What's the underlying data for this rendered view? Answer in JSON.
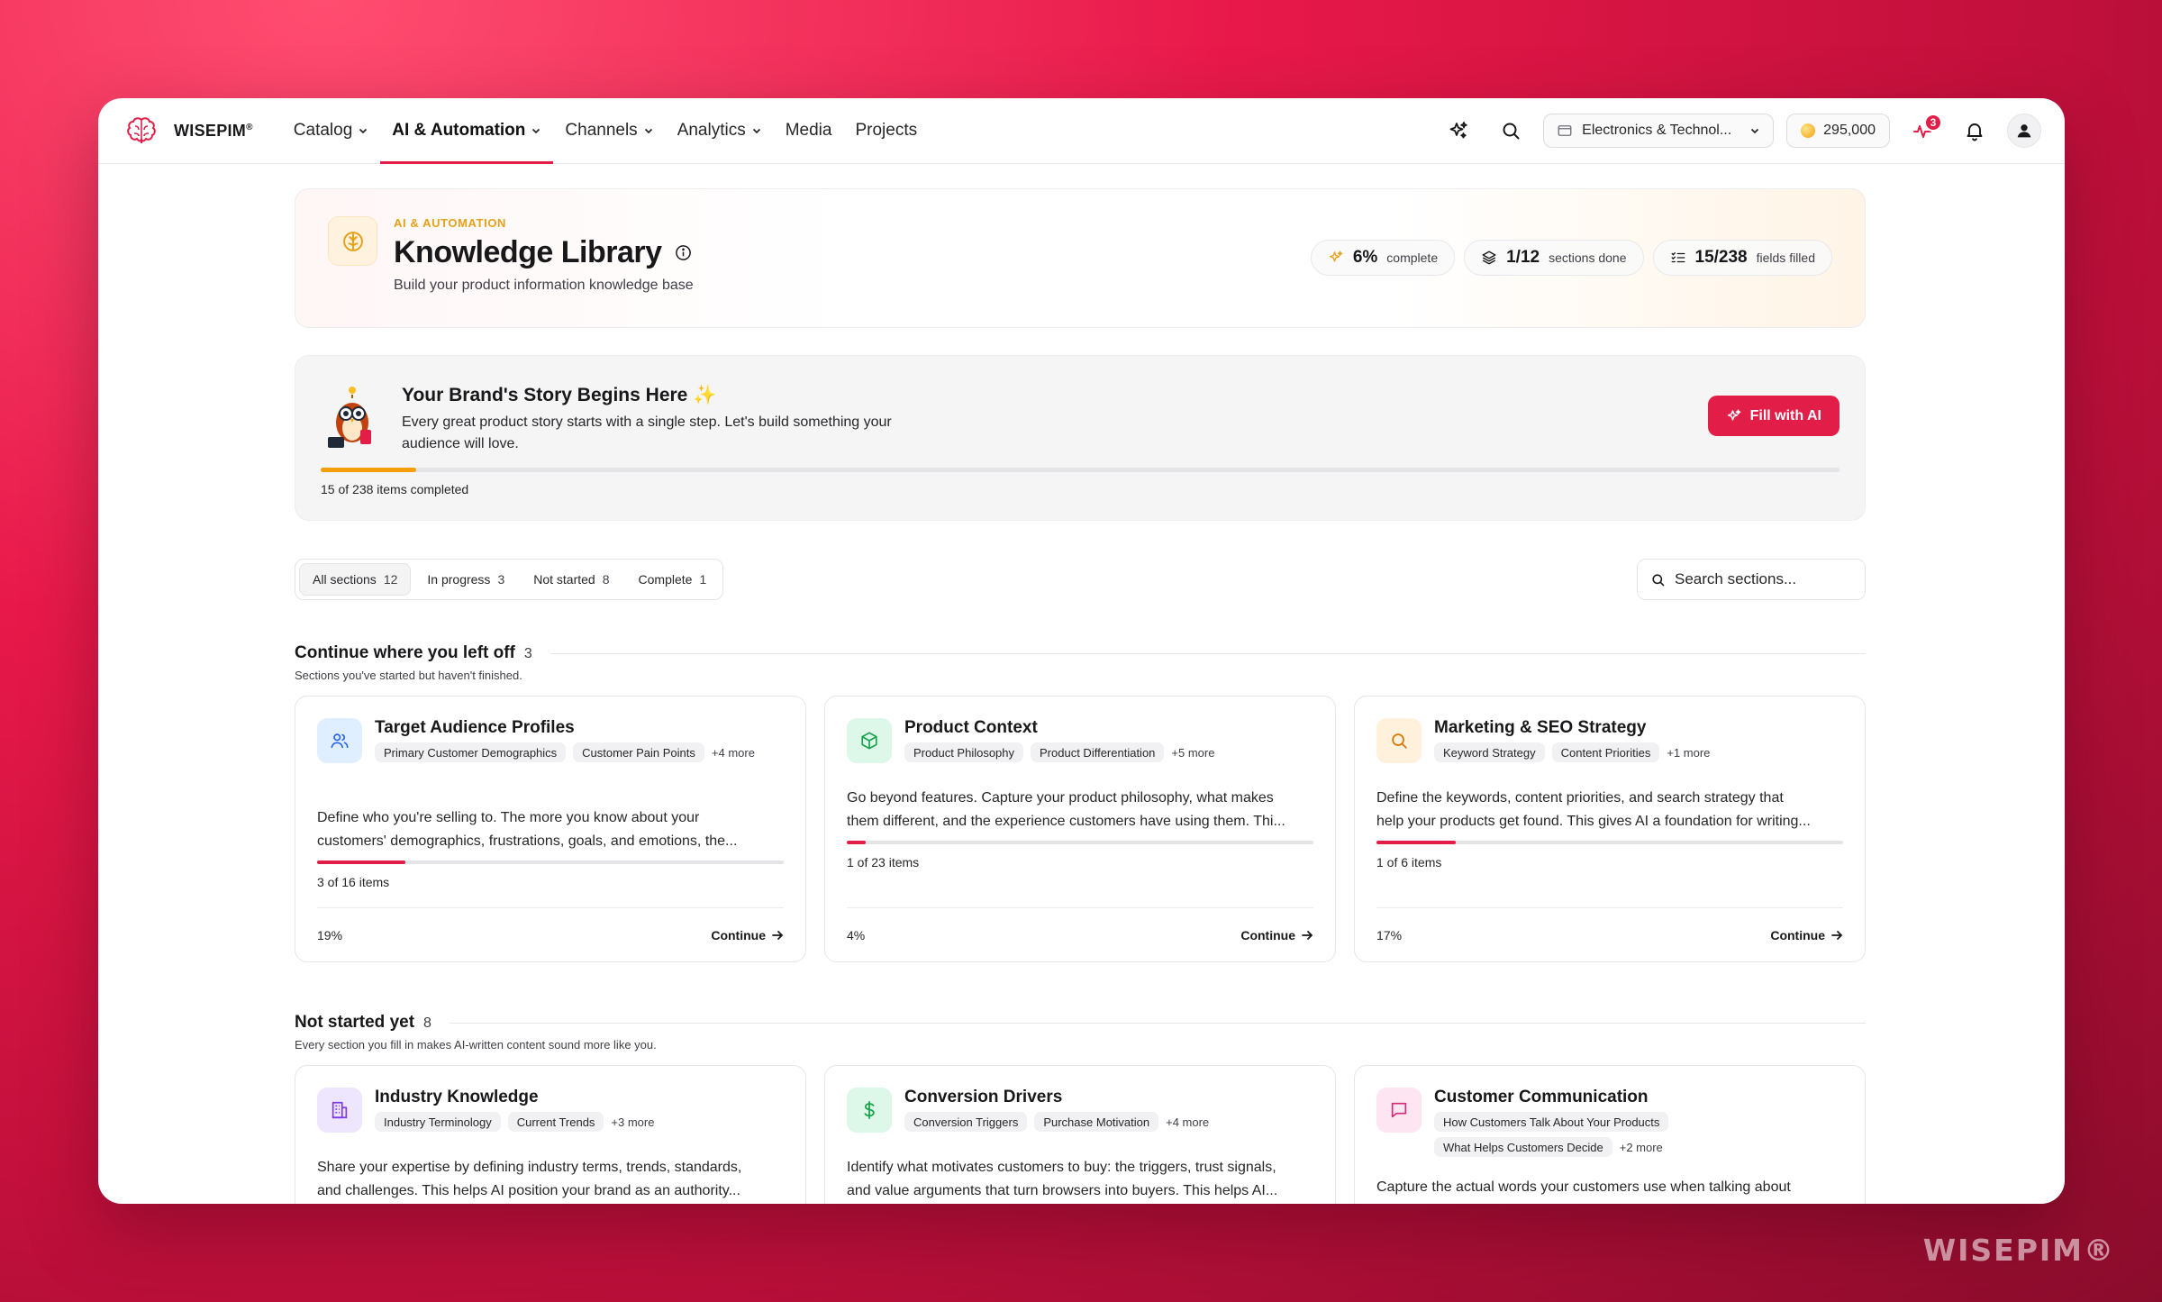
{
  "brand": {
    "name": "WISEPIM",
    "mark": "®",
    "watermark": "WISEPIM®"
  },
  "nav": {
    "items": [
      {
        "label": "Catalog",
        "dropdown": true,
        "active": false
      },
      {
        "label": "AI & Automation",
        "dropdown": true,
        "active": true
      },
      {
        "label": "Channels",
        "dropdown": true,
        "active": false
      },
      {
        "label": "Analytics",
        "dropdown": true,
        "active": false
      },
      {
        "label": "Media",
        "dropdown": false,
        "active": false
      },
      {
        "label": "Projects",
        "dropdown": false,
        "active": false
      }
    ],
    "store_selector": "Electronics & Technol...",
    "credits": "295,000",
    "activity_badge": "3"
  },
  "header": {
    "eyebrow": "AI & AUTOMATION",
    "title": "Knowledge Library",
    "subtitle": "Build your product information knowledge base",
    "stats": [
      {
        "value": "6%",
        "label": "complete",
        "icon": "sparkle-icon"
      },
      {
        "value": "1/12",
        "label": "sections done",
        "icon": "layers-icon"
      },
      {
        "value": "15/238",
        "label": "fields filled",
        "icon": "checklist-icon"
      }
    ]
  },
  "story": {
    "title": "Your Brand's Story Begins Here",
    "sparkle": "✨",
    "body": "Every great product story starts with a single step. Let's build something your audience will love.",
    "button": "Fill with AI",
    "progress_fraction": 0.063,
    "count_text": "15 of 238 items completed"
  },
  "filters": {
    "tabs": [
      {
        "label": "All sections",
        "count": "12",
        "active": true
      },
      {
        "label": "In progress",
        "count": "3",
        "active": false
      },
      {
        "label": "Not started",
        "count": "8",
        "active": false
      },
      {
        "label": "Complete",
        "count": "1",
        "active": false
      }
    ],
    "search_placeholder": "Search sections..."
  },
  "sections": [
    {
      "title": "Continue where you left off",
      "count": "3",
      "subtitle": "Sections you've started but haven't finished.",
      "cards": [
        {
          "title": "Target Audience Profiles",
          "icon": "users-icon",
          "icon_color": "#2563eb",
          "icon_bg": "#e0efff",
          "tags": [
            "Primary Customer Demographics",
            "Customer Pain Points"
          ],
          "more": "+4 more",
          "desc_lines": [
            "Define who you're selling to. The more you know about your",
            "customers' demographics, frustrations, goals, and emotions, the..."
          ],
          "progress": 0.19,
          "items": "3 of 16 items",
          "pct": "19%",
          "cta": "Continue"
        },
        {
          "title": "Product Context",
          "icon": "cube-icon",
          "icon_color": "#16a34a",
          "icon_bg": "#ddf7e8",
          "tags": [
            "Product Philosophy",
            "Product Differentiation"
          ],
          "more": "+5 more",
          "desc_lines": [
            "Go beyond features. Capture your product philosophy, what makes",
            "them different, and the experience customers have using them. Thi..."
          ],
          "progress": 0.04,
          "items": "1 of 23 items",
          "pct": "4%",
          "cta": "Continue"
        },
        {
          "title": "Marketing & SEO Strategy",
          "icon": "search-icon",
          "icon_color": "#d97706",
          "icon_bg": "#fff1dc",
          "tags": [
            "Keyword Strategy",
            "Content Priorities"
          ],
          "more": "+1 more",
          "desc_lines": [
            "Define the keywords, content priorities, and search strategy that",
            "help your products get found. This gives AI a foundation for writing..."
          ],
          "progress": 0.17,
          "items": "1 of 6 items",
          "pct": "17%",
          "cta": "Continue"
        }
      ]
    },
    {
      "title": "Not started yet",
      "count": "8",
      "subtitle": "Every section you fill in makes AI-written content sound more like you.",
      "cards": [
        {
          "title": "Industry Knowledge",
          "icon": "building-icon",
          "icon_color": "#7c3aed",
          "icon_bg": "#eee6ff",
          "tags": [
            "Industry Terminology",
            "Current Trends"
          ],
          "more": "+3 more",
          "desc_lines": [
            "Share your expertise by defining industry terms, trends, standards,",
            "and challenges. This helps AI position your brand as an authority..."
          ]
        },
        {
          "title": "Conversion Drivers",
          "icon": "dollar-icon",
          "icon_color": "#16a34a",
          "icon_bg": "#ddf7e8",
          "tags": [
            "Conversion Triggers",
            "Purchase Motivation"
          ],
          "more": "+4 more",
          "desc_lines": [
            "Identify what motivates customers to buy: the triggers, trust signals,",
            "and value arguments that turn browsers into buyers. This helps AI..."
          ]
        },
        {
          "title": "Customer Communication",
          "icon": "chat-icon",
          "icon_color": "#db2777",
          "icon_bg": "#fde6f1",
          "tags": [
            "How Customers Talk About Your Products",
            "What Helps Customers Decide"
          ],
          "more": "+2 more",
          "desc_lines": [
            "Capture the actual words your customers use when talking about"
          ]
        }
      ]
    }
  ],
  "colors": {
    "accent": "#e11d48",
    "eyebrow": "#e6a11a",
    "story_progress": "#f59e0b"
  }
}
